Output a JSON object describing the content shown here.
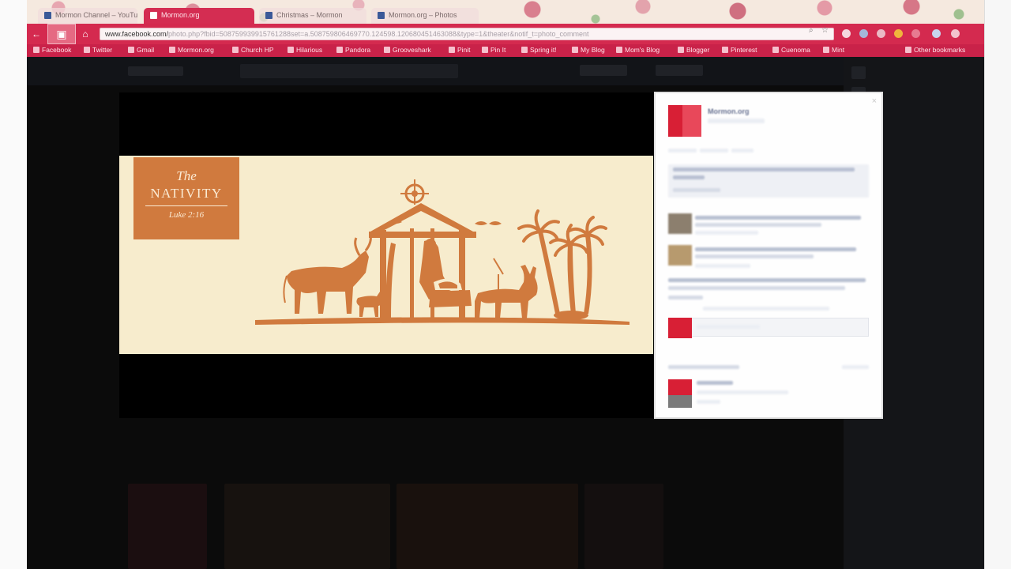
{
  "tabs": [
    {
      "label": "Mormon Channel – YouTube",
      "active": false
    },
    {
      "label": "Mormon.org",
      "active": true
    },
    {
      "label": "Christmas – Mormon",
      "active": false
    },
    {
      "label": "Mormon.org – Photos",
      "active": false
    }
  ],
  "toolbar": {
    "watermark_icon": "camera-icon",
    "url_host": "www.facebook.com/",
    "url_rest": "photo.php?fbid=508759939915761288set=a.508759806469770.124598.120680451463088&type=1&theater&notif_t=photo_comment"
  },
  "bookmarks": [
    "Facebook",
    "Twitter",
    "Gmail",
    "Mormon.org",
    "Church HP",
    "Hilarious",
    "Pandora",
    "Grooveshark",
    "Pinit",
    "Pin It",
    "Spring it!",
    "My Blog",
    "Mom's Blog",
    "Blogger",
    "Pinterest",
    "Cuenoma",
    "Mint",
    "Other bookmarks"
  ],
  "photo": {
    "title_the": "The",
    "title_nativity": "NATIVITY",
    "reference": "Luke 2:16"
  },
  "panel": {
    "close_glyph": "×",
    "page_name": "Mormon.org"
  },
  "colors": {
    "chrome_accent": "#d42a4f",
    "parchment": "#f7eccd",
    "silhouette": "#d07a3e",
    "brand_red": "#d81f35"
  }
}
